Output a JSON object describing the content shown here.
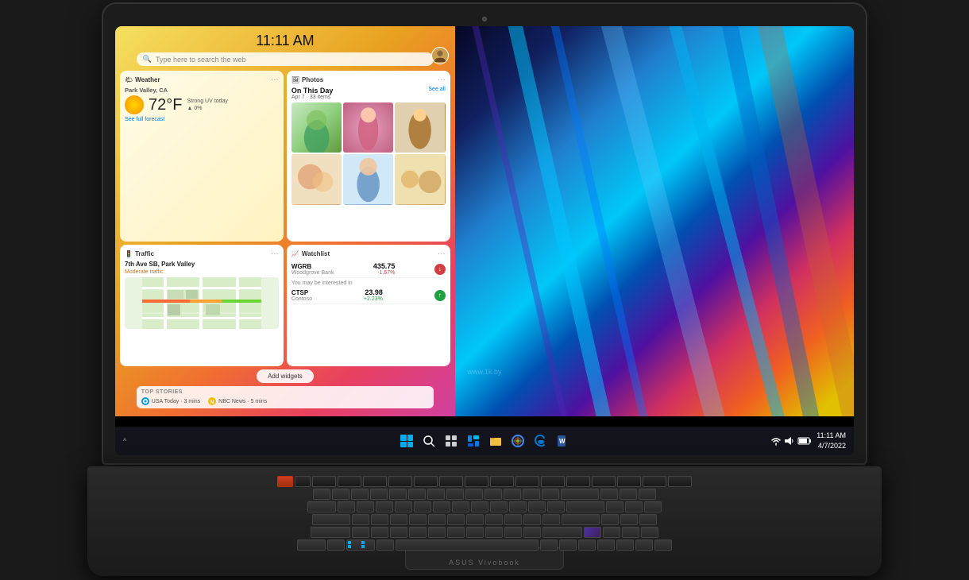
{
  "laptop": {
    "brand": "ASUS Vivobook",
    "model": "ASUS Vivobook"
  },
  "desktop": {
    "time": "11:11 AM",
    "search_placeholder": "Type here to search the web"
  },
  "widgets": {
    "weather": {
      "title": "Weather",
      "location": "Park Valley, CA",
      "temperature": "72°F",
      "condition": "Strong UV today",
      "precipitation": "▲ 0%",
      "link": "See full forecast"
    },
    "photos": {
      "title": "Photos",
      "feature_title": "On This Day",
      "date": "Apr 7",
      "count": "33 items",
      "see_all": "See all"
    },
    "traffic": {
      "title": "Traffic",
      "address": "7th Ave SB, Park Valley",
      "status": "Moderate traffic"
    },
    "watchlist": {
      "title": "Watchlist",
      "stocks": [
        {
          "ticker": "WGRB",
          "company": "Woodgrove Bank",
          "price": "435.75",
          "change": "-1.67%",
          "direction": "down"
        }
      ],
      "may_interest": "You may be interested in",
      "suggested": [
        {
          "ticker": "CTSP",
          "company": "Contoso",
          "price": "23.98",
          "change": "+2.23%",
          "direction": "up"
        }
      ]
    }
  },
  "add_widgets_label": "Add widgets",
  "top_stories": {
    "title": "TOP STORIES",
    "items": [
      {
        "source": "USA Today",
        "time": "3 mins"
      },
      {
        "source": "NBC News",
        "time": "5 mins"
      }
    ]
  },
  "taskbar": {
    "clock_time": "11:11 AM",
    "clock_date": "4/7/2022",
    "icons": [
      "windows",
      "search",
      "taskview",
      "widgets",
      "fileexplorer",
      "browser",
      "edge",
      "word"
    ]
  },
  "watermark": "www.1k.by"
}
